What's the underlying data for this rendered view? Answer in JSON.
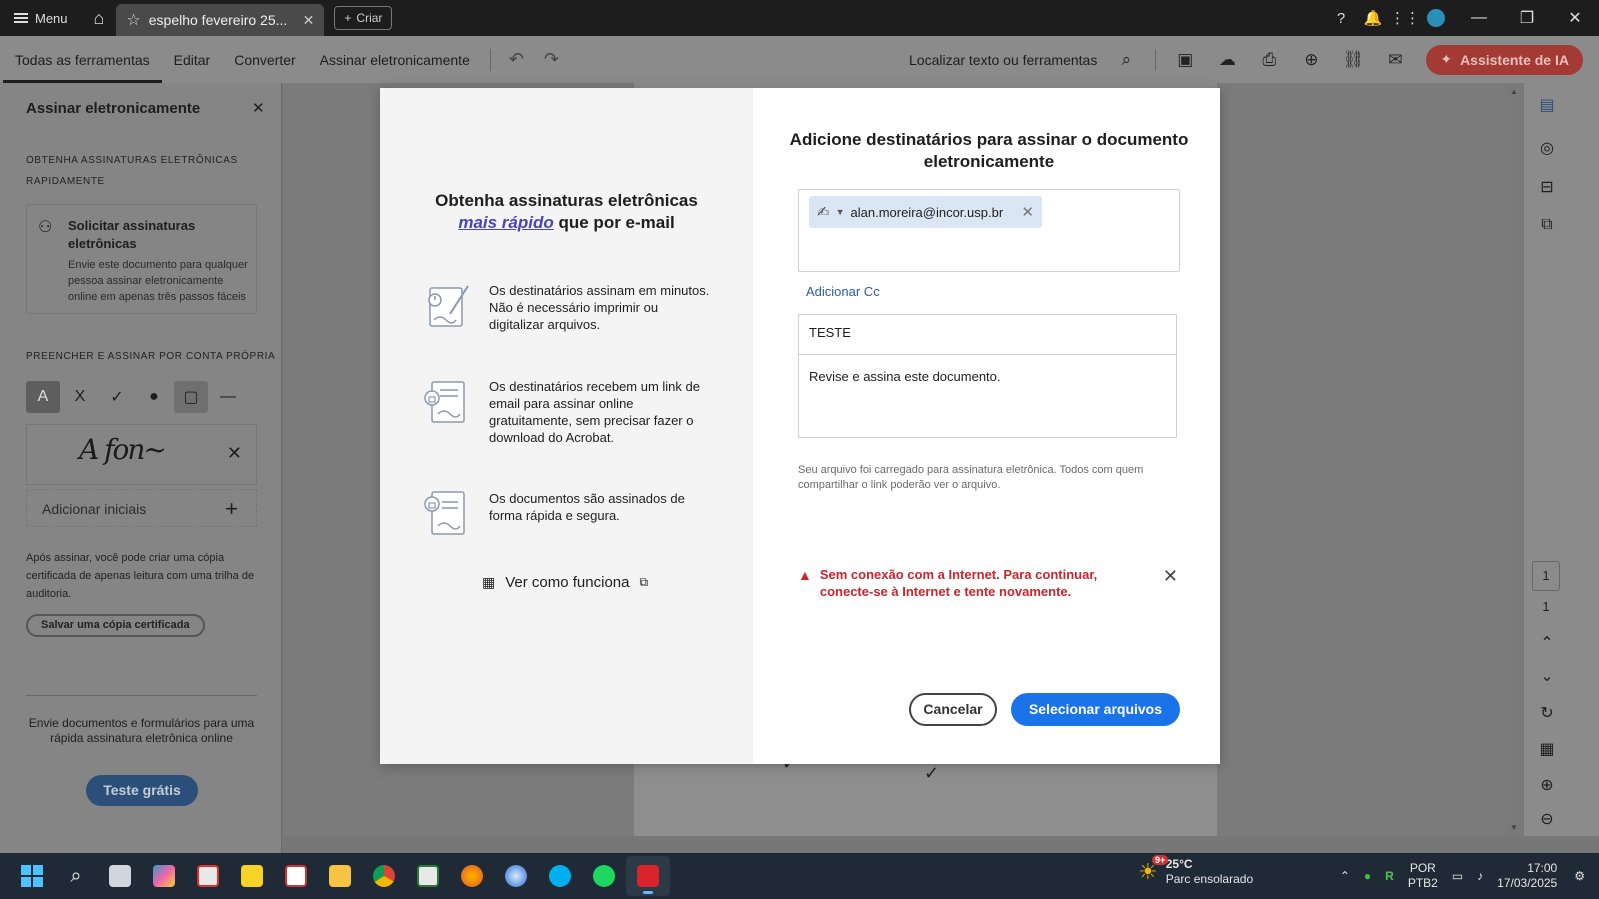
{
  "titlebar": {
    "menu_label": "Menu",
    "tab_title": "espelho fevereiro 25...",
    "create_label": "Criar"
  },
  "toolbar": {
    "tabs": [
      "Todas as ferramentas",
      "Editar",
      "Converter",
      "Assinar eletronicamente"
    ],
    "find_label": "Localizar texto ou ferramentas",
    "ai_label": "Assistente de IA"
  },
  "left_panel": {
    "title": "Assinar eletronicamente",
    "section1": "OBTENHA ASSINATURAS ELETRÔNICAS RAPIDAMENTE",
    "request_title": "Solicitar assinaturas eletrônicas",
    "request_desc": "Envie este documento para qualquer pessoa assinar eletronicamente online em apenas três passos fáceis",
    "section2": "PREENCHER E ASSINAR POR CONTA PRÓPRIA",
    "add_initials": "Adicionar iniciais",
    "note": "Após assinar, você pode criar uma cópia certificada de apenas leitura com uma trilha de auditoria.",
    "cert_copy": "Salvar uma cópia certificada",
    "promo": "Envie documentos e formulários para uma rápida assinatura eletrônica online",
    "trial": "Teste grátis"
  },
  "modal": {
    "left_title_1": "Obtenha assinaturas eletrônicas",
    "left_title_hl": "mais rápido",
    "left_title_2": "que por e-mail",
    "features": [
      "Os destinatários assinam em minutos. Não é necessário imprimir ou digitalizar arquivos.",
      "Os destinatários recebem um link de email para assinar online gratuitamente, sem precisar fazer o download do Acrobat.",
      "Os documentos são assinados de forma rápida e segura."
    ],
    "how_it_works": "Ver como funciona",
    "right_title": "Adicione destinatários para assinar o documento eletronicamente",
    "recipient_email": "alan.moreira@incor.usp.br",
    "add_cc": "Adicionar Cc",
    "subject": "TESTE",
    "message": "Revise e assina este documento.",
    "file_note": "Seu arquivo foi carregado para assinatura eletrônica. Todos com quem compartilhar o link poderão ver o arquivo.",
    "error": "Sem conexão com a Internet. Para continuar, conecte-se à Internet e tente novamente.",
    "cancel": "Cancelar",
    "select_files": "Selecionar arquivos"
  },
  "right_rail": {
    "page_current": "1",
    "page_total": "1"
  },
  "taskbar": {
    "weather_badge": "9+",
    "temperature": "25°C",
    "weather_desc": "Parc ensolarado",
    "lang": "POR",
    "layout": "PTB2",
    "time": "17:00",
    "date": "17/03/2025"
  },
  "colors": {
    "primary_blue": "#1a73e8",
    "error_red": "#c9252c",
    "ai_red": "#a33a34",
    "highlight_purple": "#4b44b5"
  }
}
